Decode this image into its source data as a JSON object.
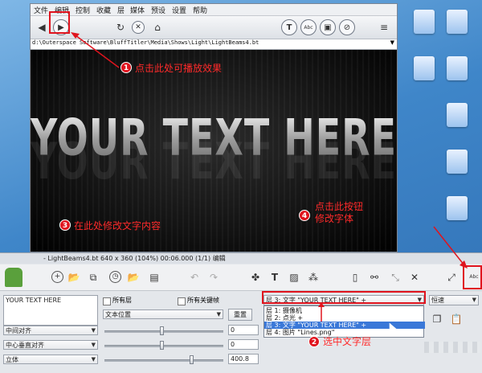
{
  "menu": [
    "文件",
    "编辑",
    "控制",
    "收藏",
    "层",
    "媒体",
    "预设",
    "设置",
    "帮助"
  ],
  "toolbar": {
    "back_icon": "back-arrow-icon",
    "play_icon": "play-icon",
    "reload_icon": "reload-icon",
    "stop_icon": "stop-icon",
    "home_icon": "home-icon",
    "text_icon_label": "T",
    "abc_icon_label": "Abc",
    "menu_icon": "hamburger-menu-icon"
  },
  "path": "d:\\Outerspace Software\\BluffTitler\\Media\\Shows\\Light\\LightBeams4.bt",
  "preview_text": "YOUR TEXT HERE",
  "statusbar": "- LightBeams4.bt 640 x 360 (104%) 00:06.000 (1/1) 编辑",
  "editor": {
    "text_value": "YOUR TEXT HERE",
    "all_layers_label": "所有层",
    "all_keyframes_label": "所有关键帧",
    "text_position_option": "文本位置",
    "reset_label": "重置",
    "h_align_option": "中间对齐",
    "v_align_option": "中心垂直对齐",
    "style_option": "立体",
    "value1": "0",
    "value2": "0",
    "value3": "400.8",
    "layer_combo_value": "层 3: 文字 \"YOUR TEXT HERE\" +",
    "speed_option": "恒速",
    "layers": [
      "层 1: 摄像机",
      "层 2: 点光 +",
      "层 3: 文字 \"YOUR TEXT HERE\" +",
      "层 4: 图片 \"Lines.png\""
    ],
    "selected_layer_index": 2
  },
  "callouts": [
    {
      "num": "1",
      "text": "点击此处可播放效果"
    },
    {
      "num": "2",
      "text": "选中文字层"
    },
    {
      "num": "3",
      "text": "在此处修改文字内容"
    },
    {
      "num": "4",
      "text": "点击此按钮",
      "text2": "修改字体"
    }
  ],
  "colors": {
    "annotation": "#e0141e",
    "selection": "#3a78d8"
  }
}
